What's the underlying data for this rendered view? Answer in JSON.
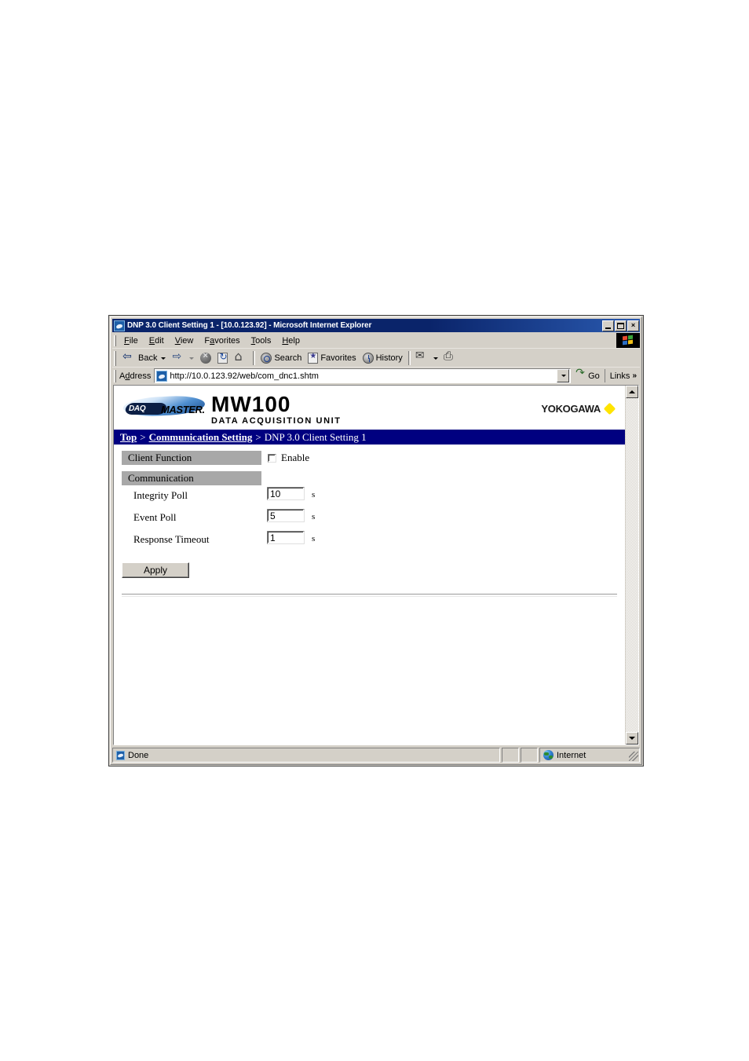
{
  "window": {
    "title": "DNP 3.0 Client Setting 1 - [10.0.123.92] - Microsoft Internet Explorer",
    "icon": "ie-document-icon",
    "minimize_label": "_",
    "maximize_label": "□",
    "close_label": "×"
  },
  "menu": {
    "items": [
      {
        "label": "File",
        "accel": "F"
      },
      {
        "label": "Edit",
        "accel": "E"
      },
      {
        "label": "View",
        "accel": "V"
      },
      {
        "label": "Favorites",
        "accel": "a"
      },
      {
        "label": "Tools",
        "accel": "T"
      },
      {
        "label": "Help",
        "accel": "H"
      }
    ]
  },
  "toolbar": {
    "back_label": "Back",
    "forward_label": "",
    "stop_label": "",
    "refresh_label": "",
    "home_label": "",
    "search_label": "Search",
    "favorites_label": "Favorites",
    "history_label": "History",
    "mail_label": "",
    "print_label": ""
  },
  "address": {
    "label": "Address",
    "value": "http://10.0.123.92/web/com_dnc1.shtm",
    "placeholder": "",
    "go_label": "Go",
    "links_label": "Links",
    "links_chevron": "»"
  },
  "page": {
    "brand": {
      "daq_pill": "DAQ",
      "daq_master": "MASTER.",
      "model": "MW100",
      "model_sub": "DATA ACQUISITION UNIT",
      "company": "YOKOGAWA",
      "company_mark": "diamond"
    },
    "breadcrumb": {
      "top": "Top",
      "sep1": ">",
      "section": "Communication Setting",
      "sep2": ">",
      "current": "DNP 3.0 Client Setting 1"
    },
    "sections": {
      "client_function": {
        "title": "Client Function",
        "enable_label": "Enable",
        "enable_checked": false
      },
      "communication": {
        "title": "Communication",
        "fields": [
          {
            "label": "Integrity Poll",
            "value": "10",
            "unit": "s"
          },
          {
            "label": "Event Poll",
            "value": "5",
            "unit": "s"
          },
          {
            "label": "Response Timeout",
            "value": "1",
            "unit": "s"
          }
        ]
      }
    },
    "apply_label": "Apply"
  },
  "statusbar": {
    "message": "Done",
    "zone": "Internet"
  },
  "colors": {
    "titlebar": "#0a246a",
    "breadcrumb": "#000080",
    "section_bar": "#a8a8a8",
    "chrome": "#d4d0c8",
    "accent_yellow": "#ffe400"
  }
}
